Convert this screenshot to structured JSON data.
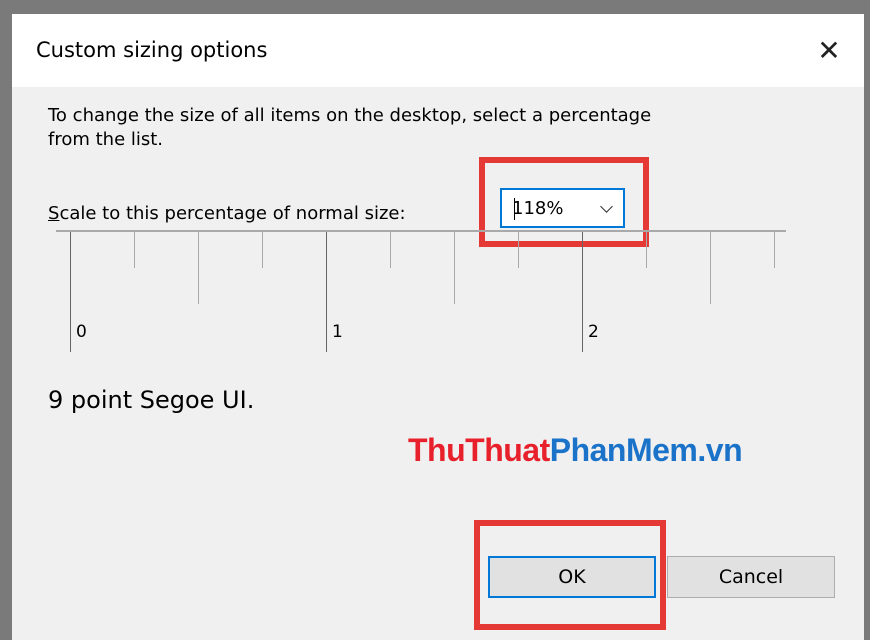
{
  "dialog": {
    "title": "Custom sizing options",
    "close_glyph": "✕",
    "description": "To change the size of all items on the desktop, select a percentage from the list.",
    "scale_label_accel": "S",
    "scale_label_rest": "cale to this percentage of normal size:",
    "scale_value": "118%",
    "ruler_labels": [
      "0",
      "1",
      "2"
    ],
    "font_info": "9 point Segoe UI.",
    "ok_label": "OK",
    "cancel_label": "Cancel"
  },
  "watermark": {
    "part1": "ThuThuat",
    "part2": "PhanMem.vn"
  },
  "colors": {
    "highlight": "#e53935",
    "focus": "#0078d7",
    "watermark_red": "#e8202b",
    "watermark_blue": "#1b72c9"
  },
  "icons": {
    "close": "close-icon",
    "dropdown": "chevron-down-icon"
  }
}
